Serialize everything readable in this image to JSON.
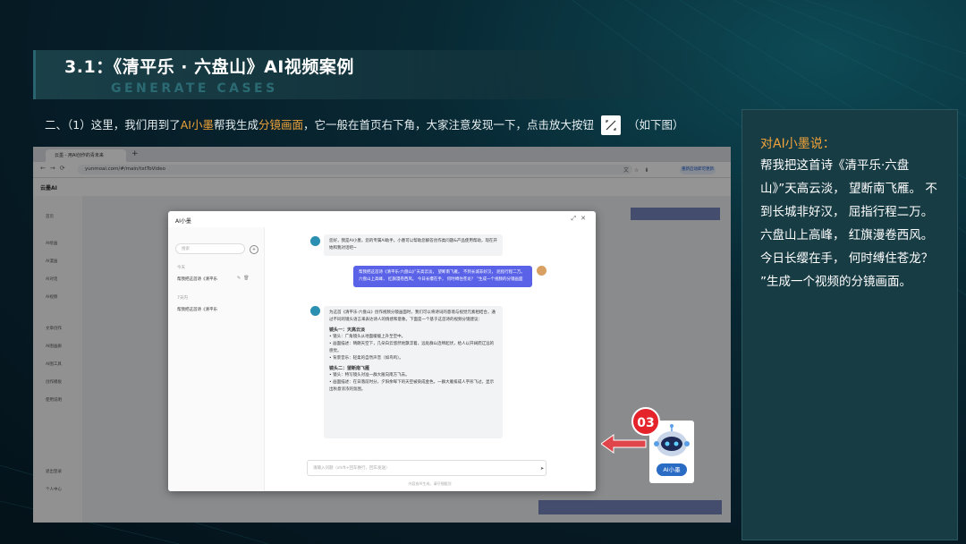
{
  "slide": {
    "title": "3.1：《清平乐 · 六盘山》AI视频案例",
    "subtitle": "GENERATE CASES",
    "instruction": {
      "prefix": "二、（1）这里，我们用到了",
      "highlight1": "AI小墨",
      "middle1": "帮我生成",
      "highlight2": "分镜画面",
      "middle2": "，它一般在首页右下角，大家注意发现一下，点击放大按钮",
      "suffix": "（如下图）"
    },
    "badge": "03",
    "ai_icon_label": "AI小墨"
  },
  "side_panel": {
    "heading": "对AI小墨说：",
    "body": "帮我把这首诗《清平乐·六盘山》”天高云淡， 望断南飞雁。 不到长城非好汉， 屈指行程二万。 六盘山上高峰， 红旗漫卷西风。 今日长缨在手， 何时缚住苍龙？ ”生成一个视频的分镜画面。"
  },
  "browser": {
    "tab_title": "云墨 - 用AI创作的青未来",
    "url": "yunmoai.com/#/main/txtToVideo",
    "update_label": "重新启动即可更新",
    "app_logo": "云墨AI",
    "sidebar_items": [
      "首页",
      "",
      "AI绘画",
      "AI漫画",
      "AI对话",
      "AI视频",
      "",
      "文章创作",
      "AI图画廊",
      "AI图工具",
      "创作模板",
      "使用说明",
      "",
      "退出登录",
      "个人中心"
    ]
  },
  "dialog": {
    "title": "AI小墨",
    "search_placeholder": "搜索",
    "history_today_label": "今天",
    "history_today_item": "帮我把这首诗《清平乐",
    "history_week_label": "7天内",
    "history_week_item": "帮我把这首诗《清平乐",
    "bot_greeting": "您好，我是AI小墨，您的专属AI助手。小墨可以帮助您解答创作类问题&产品使用帮助，现在开始和我对话吧~",
    "user_message": "帮我把这首诗《清平乐·六盘山》”天高云淡， 望断南飞雁。 不到长城非好汉， 屈指行程二万。 六盘山上高峰， 红旗漫卷西风。 今日长缨在手， 何时缚住苍龙？ ”生成一个视频的分镜画面",
    "bot_reply_intro": "为这首《清平乐·六盘山》创作视频分镜画面时，我们可以将诗词的意境与视觉元素相结合，通过不同的镜头语言来表达诗人的情感和意象。下面是一个基于这首诗的视频分镜建议：",
    "scene1_title": "镜头一：天高云淡",
    "scene1_items": [
      "镜头：广角镜头从地面缓缓上升至空中。",
      "画面描述：晴朗天空下，几朵白云悠然地飘浮着，远处群山连绵起伏，给人以开阔而辽远的感觉。",
      "背景音乐：轻柔的自然声音（如鸟鸣）。"
    ],
    "scene2_title": "镜头二：望断南飞雁",
    "scene2_items": [
      "镜头：特写镜头对准一群大雁向南方飞去。",
      "画面描述：在日落前时分，夕阳余晖下的天空被染成金色，一群大雁排成人字形飞过，显示出秋意浓浓的氛围。"
    ],
    "input_placeholder": "请输入问题（shift+回车换行，回车发送）",
    "disclaimer": "内容由AI生成，请仔细甄别"
  },
  "colors": {
    "accent_orange": "#f0a33a",
    "badge_red": "#e4232b",
    "user_bubble": "#5a63e8"
  }
}
